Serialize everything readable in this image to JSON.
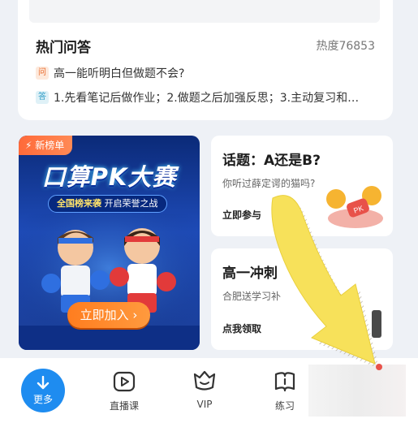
{
  "hot_qa": {
    "title": "热门问答",
    "heat": "热度76853",
    "question_badge": "问",
    "question": "高一能听明白但做题不会?",
    "answer_badge": "答",
    "answer": "1.先看笔记后做作业；2.做题之后加强反思；3.主动复习和…"
  },
  "promo": {
    "tag": "新榜单",
    "title": "口算PK大赛",
    "subtitle_strong": "全国榜来袭",
    "subtitle_rest": "开启荣誉之战",
    "button": "立即加入 ›"
  },
  "topic_card": {
    "title": "话题：A还是B?",
    "subtitle": "你听过薛定谔的猫吗?",
    "link": "立即参与",
    "pk_text": "PK"
  },
  "boost_card": {
    "title": "高一冲刺",
    "subtitle": "合肥送学习补",
    "link": "点我领取"
  },
  "bottom_nav": {
    "more": "更多",
    "live": "直播课",
    "vip": "VIP",
    "practice": "练习"
  },
  "colors": {
    "accent_blue": "#1e8cf0",
    "orange": "#ff7d1f",
    "arrow_yellow": "#f7e15a"
  }
}
